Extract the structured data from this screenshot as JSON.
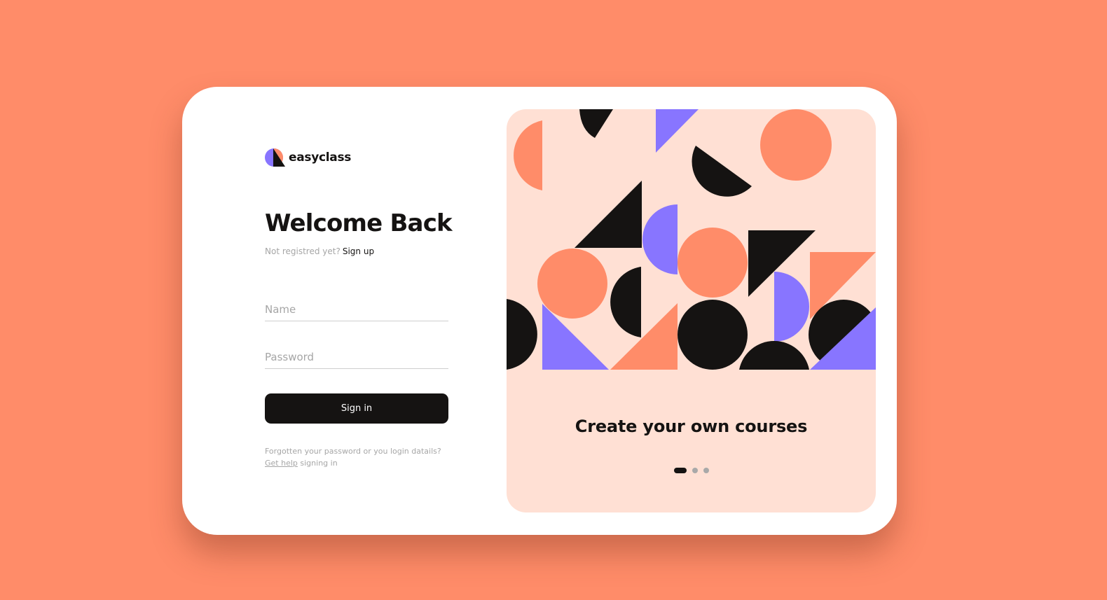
{
  "brand": {
    "name": "easyclass",
    "logo_icon": "half-circle-sail-logo-icon"
  },
  "login": {
    "title": "Welcome Back",
    "not_registered": "Not registred yet?",
    "signup_link": "Sign up",
    "name_placeholder": "Name",
    "password_placeholder": "Password",
    "signin_label": "Sign in",
    "help_line1": "Forgotten your password or you login datails?",
    "help_link": "Get help",
    "help_suffix": "signing in"
  },
  "carousel": {
    "slide_title": "Create your own courses",
    "slide_count": 3,
    "active_slide": 1
  },
  "colors": {
    "background": "#FF8C69",
    "card": "#FFFFFF",
    "panel": "#FFE0D4",
    "coral": "#FF8C69",
    "purple": "#8875FF",
    "black": "#151312"
  }
}
